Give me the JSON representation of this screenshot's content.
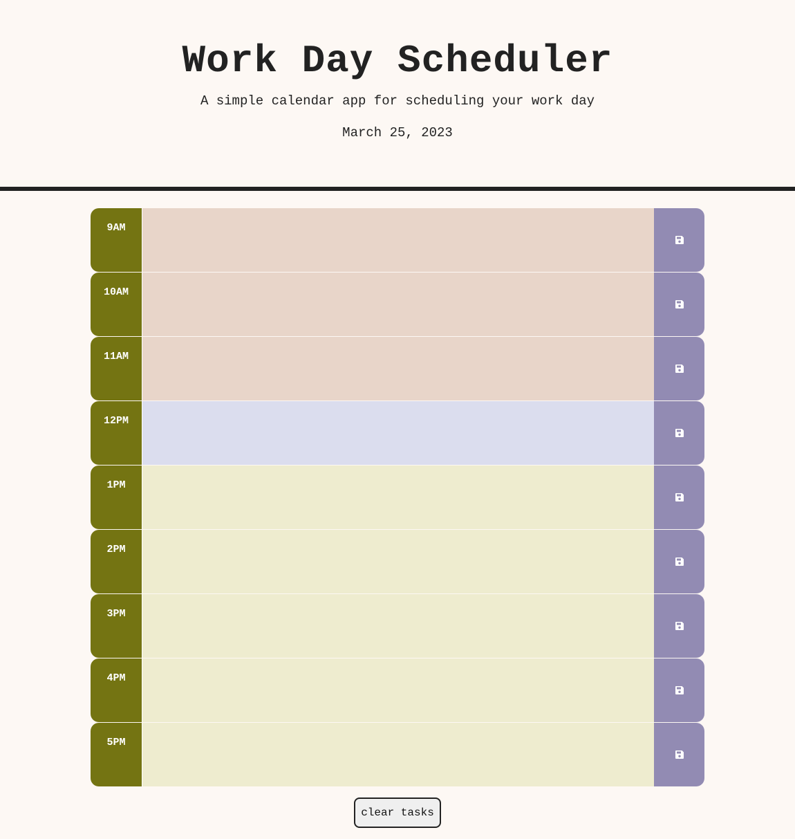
{
  "header": {
    "title": "Work Day Scheduler",
    "subtitle": "A simple calendar app for scheduling your work day",
    "date": "March 25, 2023"
  },
  "schedule": {
    "rows": [
      {
        "hour": "9AM",
        "state": "past",
        "text": ""
      },
      {
        "hour": "10AM",
        "state": "past",
        "text": ""
      },
      {
        "hour": "11AM",
        "state": "past",
        "text": ""
      },
      {
        "hour": "12PM",
        "state": "present",
        "text": ""
      },
      {
        "hour": "1PM",
        "state": "future",
        "text": ""
      },
      {
        "hour": "2PM",
        "state": "future",
        "text": ""
      },
      {
        "hour": "3PM",
        "state": "future",
        "text": ""
      },
      {
        "hour": "4PM",
        "state": "future",
        "text": ""
      },
      {
        "hour": "5PM",
        "state": "future",
        "text": ""
      }
    ],
    "save_icon": "save-icon"
  },
  "colors": {
    "hour_block": "#747412",
    "past": "#e8d5c9",
    "present": "#dbddee",
    "future": "#eeeccf",
    "save_button": "#928bb3"
  },
  "footer": {
    "clear_label": "clear tasks"
  }
}
